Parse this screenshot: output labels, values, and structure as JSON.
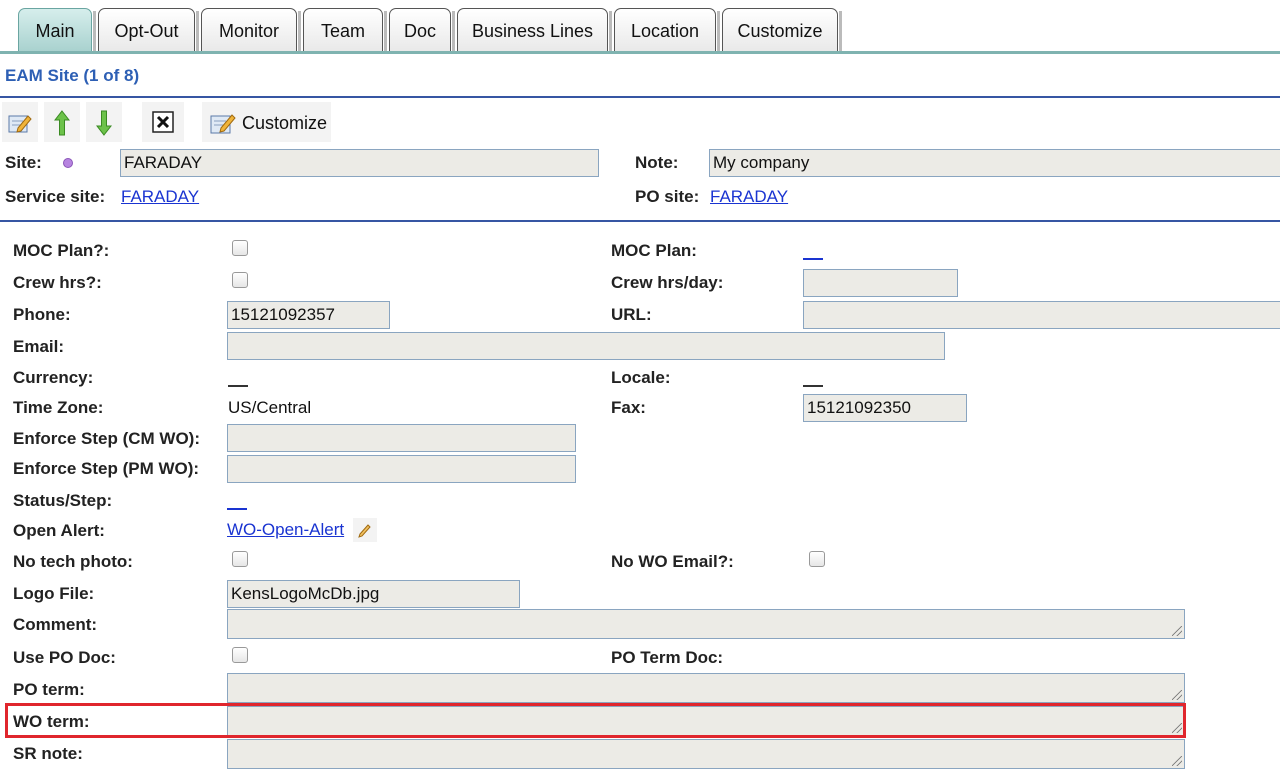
{
  "tabs": [
    "Main",
    "Opt-Out",
    "Monitor",
    "Team",
    "Doc",
    "Business Lines",
    "Location",
    "Customize"
  ],
  "active_tab": "Main",
  "header": {
    "title": "EAM Site (1 of 8)"
  },
  "toolbar": {
    "edit_icon": "edit-icon",
    "up_icon": "arrow-up-icon",
    "down_icon": "arrow-down-icon",
    "delete_icon": "close-box-icon",
    "customize_label": "Customize"
  },
  "summary": {
    "site_label": "Site:",
    "site_value": "FARADAY",
    "note_label": "Note:",
    "note_value": "My company",
    "service_site_label": "Service site:",
    "service_site_value": "FARADAY",
    "po_site_label": "PO site:",
    "po_site_value": "FARADAY"
  },
  "fields": {
    "moc_plan_q": "MOC Plan?:",
    "moc_plan": "MOC Plan:",
    "crew_hrs_q": "Crew hrs?:",
    "crew_hrs_day": "Crew hrs/day:",
    "phone": "Phone:",
    "phone_value": "15121092357",
    "url": "URL:",
    "email": "Email:",
    "currency": "Currency:",
    "locale": "Locale:",
    "time_zone": "Time Zone:",
    "time_zone_value": "US/Central",
    "fax": "Fax:",
    "fax_value": "15121092350",
    "enforce_cm": "Enforce Step (CM WO):",
    "enforce_pm": "Enforce Step (PM WO):",
    "status_step": "Status/Step:",
    "open_alert": "Open Alert:",
    "open_alert_value": "WO-Open-Alert",
    "no_tech_photo": "No tech photo:",
    "no_wo_email": "No WO Email?:",
    "logo_file": "Logo File:",
    "logo_file_value": "KensLogoMcDb.jpg",
    "comment": "Comment:",
    "use_po_doc": "Use PO Doc:",
    "po_term_doc": "PO Term Doc:",
    "po_term": "PO term:",
    "wo_term": "WO term:",
    "sr_note": "SR note:"
  },
  "colors": {
    "accent": "#2d5fb4",
    "tab_active": "#a9d2cf",
    "link": "#1a34d1",
    "highlight": "#e0262d",
    "input_bg": "#ecebe6"
  }
}
